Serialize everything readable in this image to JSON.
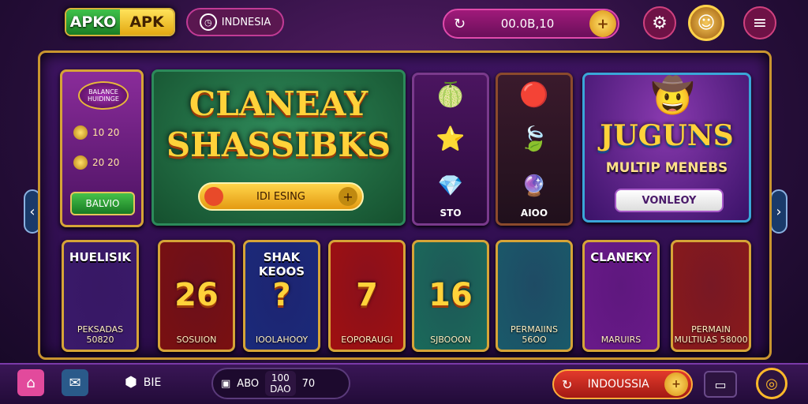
{
  "header": {
    "brand_left": "APKO",
    "brand_right": "APK",
    "region_icon": "clock-icon",
    "region": "INDNESIA",
    "balance": "00.0B,10",
    "settings_icon": "gear-icon",
    "menu_icon": "hamburger-icon"
  },
  "promo": {
    "badge": "BALANCE HUIDINGE",
    "row1": "10 20",
    "row2": "20 20",
    "button": "BALVIO"
  },
  "hero": {
    "title_line1": "CLANEAY",
    "title_line2": "SHASSIBKS",
    "bar_label": "IDI ESING"
  },
  "symbols": [
    {
      "label": "STO"
    },
    {
      "label": "AIOO"
    }
  ],
  "feature": {
    "title": "JUGUNS",
    "subtitle": "MULTIP MENEBS",
    "button": "VONLEOY"
  },
  "tiles": [
    {
      "top": "HUELISIK",
      "big": "",
      "bottom": "PEKSADAS 50820",
      "bg": "#3a1a6a"
    },
    {
      "top": "",
      "big": "26",
      "bottom": "SOSUION",
      "bg": "#7a1010"
    },
    {
      "top": "SHAK KEOOS",
      "big": "?",
      "bottom": "IOOLAHOOY",
      "bg": "#1a2a7a"
    },
    {
      "top": "",
      "big": "7",
      "bottom": "EOPORAUGI",
      "bg": "#a01010"
    },
    {
      "top": "",
      "big": "16",
      "bottom": "SJBOOON",
      "bg": "#1a6a5a"
    },
    {
      "top": "",
      "big": "",
      "bottom": "PERMAIINS 56OO",
      "bg": "#1a5a6a"
    },
    {
      "top": "CLANEKY",
      "big": "",
      "bottom": "MARUIRS",
      "bg": "#6a1a8a"
    },
    {
      "top": "",
      "big": "",
      "bottom": "PERMAIN MULTIUAS 58000",
      "bg": "#8a1a1a"
    }
  ],
  "bottom": {
    "cube_label": "BIE",
    "stat1": "ABO",
    "stat2_top": "100",
    "stat2_bottom": "DAO",
    "stat3": "70",
    "lang": "INDOUSSIA",
    "target_icon": "target-icon"
  }
}
